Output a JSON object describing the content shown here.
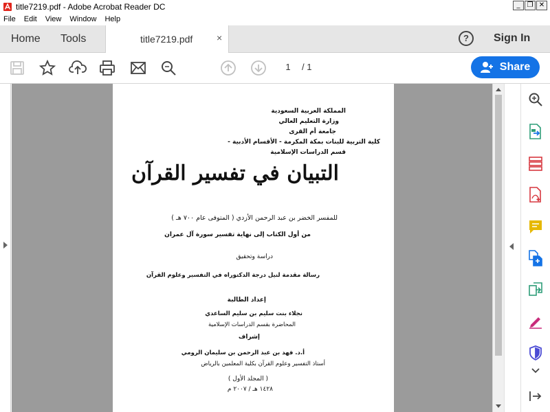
{
  "window": {
    "title": "title7219.pdf - Adobe Acrobat Reader DC",
    "buttons": [
      "_",
      "❐",
      "✕"
    ]
  },
  "menu": [
    "File",
    "Edit",
    "View",
    "Window",
    "Help"
  ],
  "tabs": {
    "home": "Home",
    "tools": "Tools",
    "document": "title7219.pdf",
    "close": "×"
  },
  "header": {
    "help": "?",
    "sign_in": "Sign In"
  },
  "toolbar": {
    "icons": [
      "save-icon",
      "bookmark-star-icon",
      "upload-cloud-icon",
      "print-icon",
      "email-icon",
      "search-zoom-icon",
      "previous-page-icon",
      "next-page-icon"
    ],
    "page_current": "1",
    "page_total": "/ 1",
    "share_label": "Share"
  },
  "page": {
    "header_lines": [
      "المملكة العربية السعودية",
      "وزارة التعليم العالي",
      "جامعة أم القرى",
      "كلية التربية للبنات بمكة المكرمة - الأقسام الأدبية -",
      "قسم الدراسات الإسلامية"
    ],
    "main_title": "التبيان في تفسير القرآن",
    "author_line": "للمفسر الخضر بن عبد الرحمن الأزدي ( المتوفى عام ٧٠٠ هـ )",
    "scope_line": "من أول الكتاب إلى نهاية تفسير سورة آل عمران",
    "study_line": "دراسة وتحقيق",
    "thesis_line": "رسالة مقدمة لنيل درجة الدكتوراه في التفسير وعلوم القرآن",
    "prepared_label": "إعداد الطالبة",
    "student_name": "نجلاء بنت سليم بن سليم الساعدي",
    "student_role": "المحاضرة بقسم الدراسات الإسلامية",
    "supervision_label": "إشراف",
    "supervisor_name": "أ.د. فهد بن عبد الرحمن بن سليمان الرومي",
    "supervisor_role": "أستاذ التفسير وعلوم القرآن بكلية المعلمين بالرياض",
    "volume": "( المجلد الأول )",
    "date": "١٤٢٨ هـ / ٢٠٠٧ م"
  },
  "rail": {
    "icons": [
      "zoom-tool-icon",
      "export-pdf-icon",
      "organize-pages-icon",
      "create-pdf-icon",
      "comment-icon",
      "combine-files-icon",
      "compress-pdf-icon",
      "fill-sign-icon",
      "protect-icon",
      "chevron-down-icon",
      "collapse-panel-icon"
    ]
  },
  "colors": {
    "share": "#1473e6",
    "doc_background": "#9b9b9b"
  }
}
